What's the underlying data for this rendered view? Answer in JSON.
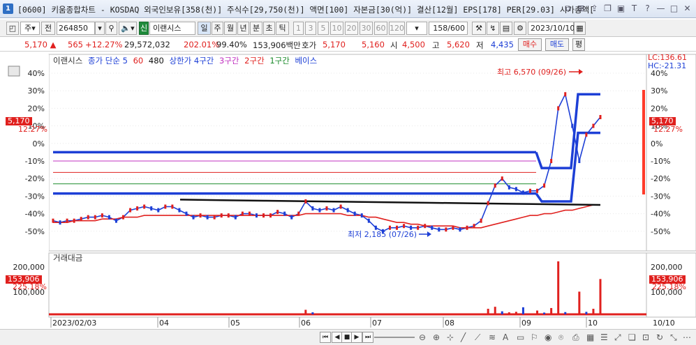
{
  "titlebar": {
    "badge": "1",
    "title": "[0600] 키움종합차트 - KOSDAQ 외국인보유[358(천)] 주식수[29,750(천)] 액면[100] 자본금[30(억)] 결산[12월] EPS[178] PER[29.03] 시가총액[",
    "buttons": [
      "□",
      "⊞",
      "⇧",
      "☐",
      "▣",
      "T",
      "?",
      "|",
      "—",
      "□",
      "✕"
    ]
  },
  "toolbar": {
    "market_label": "주",
    "prev_label": "전",
    "code": "264850",
    "stock_badge": "신",
    "stock_name": "이랜시스",
    "periods": [
      "일",
      "주",
      "월",
      "년",
      "분",
      "초",
      "틱"
    ],
    "period_active": "일",
    "intervals": [
      "1",
      "3",
      "5",
      "10",
      "20",
      "30",
      "60",
      "120"
    ],
    "count": "158/600",
    "date": "2023/10/10"
  },
  "quote": {
    "price": "5,170",
    "change": "565",
    "change_pct": "+12.27%",
    "volume": "29,572,032",
    "volume_ratio": "202.01%",
    "ratio2": "99.40%",
    "amount": "153,906백만",
    "bid_label": "호가",
    "bid": "5,170",
    "bid2": "5,160",
    "open_label": "시",
    "open": "4,500",
    "high_label": "고",
    "high": "5,620",
    "low_label": "저",
    "low": "4,435",
    "buy": "매수",
    "sell": "매도",
    "avg": "평"
  },
  "legend": {
    "name": "이랜시스",
    "close": "종가 단순 5",
    "ma60": "60",
    "ma480": "480",
    "limit": "상한가 4구간",
    "zone3": "3구간",
    "zone2": "2구간",
    "zone1": "1구간",
    "base": "베이스"
  },
  "lc_hc": {
    "lc": "LC:136.61",
    "hc": "HC:-21.31"
  },
  "current_tags": {
    "price": "5,170",
    "pct": "12.27%",
    "vol": "153,906",
    "vol_pct": "225.18%"
  },
  "chart_data": {
    "type": "line",
    "title": "이랜시스",
    "y_axis_pct_ticks": [
      "40%",
      "30%",
      "20%",
      "10%",
      "0%",
      "-10%",
      "-20%",
      "-30%",
      "-40%",
      "-50%"
    ],
    "y_right_ticks": [
      "40%",
      "30%",
      "20%",
      "10%",
      "0%",
      "-10%",
      "-20%",
      "-30%",
      "-40%",
      "-50%"
    ],
    "volume_ticks": [
      "200,000",
      "100,000"
    ],
    "volume_title": "거래대금",
    "x_ticks": [
      "2023/02/03",
      "04",
      "05",
      "06",
      "07",
      "08",
      "09",
      "10"
    ],
    "x_right_label": "10/10",
    "annotations": {
      "high": "최고 6,570 (09/26)",
      "low": "최저 2,185 (07/26)"
    },
    "ylim_pct": [
      -55,
      42
    ],
    "series": [
      {
        "name": "종가",
        "color": "#1d3fd6",
        "values": [
          -44,
          -45,
          -44,
          -44,
          -43,
          -42,
          -42,
          -41,
          -42,
          -44,
          -42,
          -38,
          -37,
          -36,
          -37,
          -38,
          -36,
          -36,
          -38,
          -40,
          -42,
          -41,
          -42,
          -42,
          -41,
          -41,
          -42,
          -40,
          -40,
          -41,
          -41,
          -41,
          -39,
          -40,
          -42,
          -40,
          -33,
          -37,
          -38,
          -37,
          -38,
          -36,
          -38,
          -40,
          -41,
          -44,
          -48,
          -50,
          -48,
          -48,
          -47,
          -48,
          -48,
          -47,
          -48,
          -49,
          -49,
          -48,
          -49,
          -48,
          -47,
          -44,
          -34,
          -24,
          -20,
          -25,
          -26,
          -28,
          -27,
          -27,
          -24,
          -10,
          20,
          28,
          10,
          -10,
          5,
          10,
          15
        ]
      },
      {
        "name": "60",
        "color": "#e0201e",
        "values": [
          -45,
          -45,
          -45,
          -44,
          -44,
          -44,
          -44,
          -43,
          -43,
          -43,
          -42,
          -42,
          -42,
          -41,
          -41,
          -41,
          -41,
          -41,
          -41,
          -41,
          -41,
          -41,
          -41,
          -41,
          -41,
          -41,
          -41,
          -41,
          -41,
          -41,
          -41,
          -41,
          -41,
          -41,
          -41,
          -41,
          -40,
          -40,
          -40,
          -40,
          -40,
          -40,
          -41,
          -41,
          -41,
          -42,
          -42,
          -43,
          -44,
          -45,
          -45,
          -46,
          -46,
          -47,
          -47,
          -47,
          -47,
          -47,
          -48,
          -48,
          -48,
          -48,
          -47,
          -46,
          -45,
          -44,
          -43,
          -42,
          -41,
          -41,
          -40,
          -40,
          -39,
          -38,
          -38,
          -37,
          -36,
          -35,
          -35
        ]
      },
      {
        "name": "480",
        "color": "#111111",
        "values": [
          -32,
          -32.3,
          -32.6,
          -32.9,
          -33.2,
          -33.5,
          -33.8,
          -34.1,
          -34.4,
          -34.7,
          -35
        ]
      }
    ],
    "volume": [
      0,
      0,
      0,
      0,
      0,
      0,
      0,
      0,
      0,
      0,
      0,
      0,
      0,
      0,
      0,
      0,
      0,
      0,
      0,
      0,
      0,
      0,
      0,
      0,
      0,
      0,
      0,
      0,
      0,
      0,
      0,
      0,
      0,
      0,
      0,
      0,
      18000,
      8000,
      0,
      0,
      0,
      0,
      0,
      0,
      0,
      0,
      0,
      0,
      0,
      0,
      0,
      0,
      0,
      0,
      0,
      0,
      0,
      0,
      0,
      0,
      0,
      0,
      22000,
      30000,
      12000,
      8000,
      10000,
      28000,
      0,
      15000,
      7000,
      25000,
      210000,
      9000,
      0,
      90000,
      10000,
      22000,
      140000
    ]
  }
}
